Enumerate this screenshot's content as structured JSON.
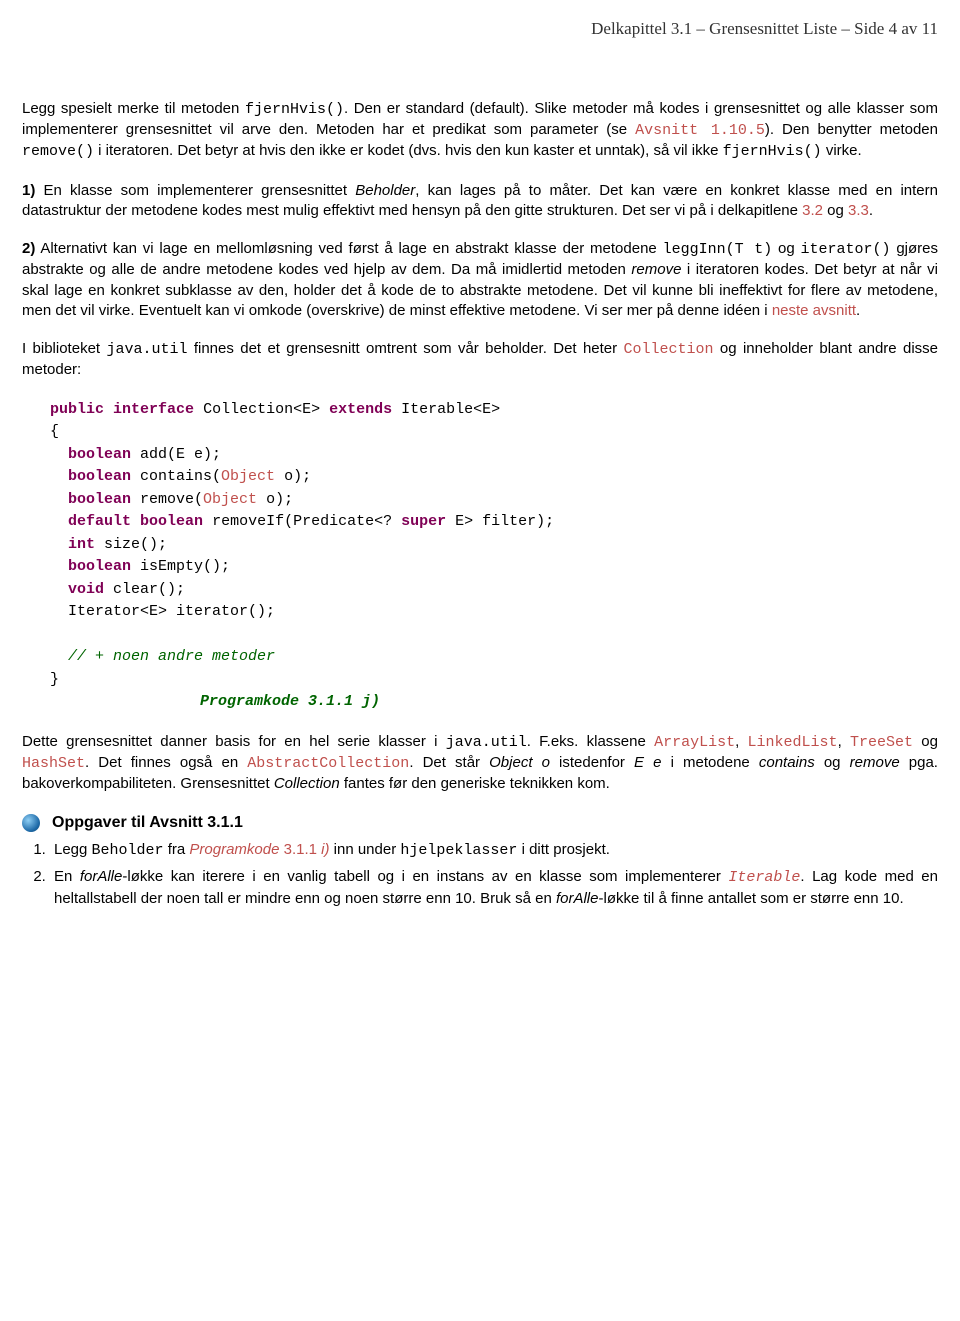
{
  "header": {
    "text": "Delkapittel 3.1 – Grensesnittet Liste  –   Side 4 av 11"
  },
  "para1": {
    "t1": "Legg spesielt merke til metoden ",
    "code1": "fjernHvis()",
    "t2": ". Den er standard (default). Slike metoder må kodes i grensesnittet og alle klasser som implementerer grensesnittet vil arve den. Metoden har et predikat som parameter (se ",
    "link1": "Avsnitt 1.10.5",
    "t3": "). Den benytter metoden ",
    "code2": "remove()",
    "t4": " i iteratoren. Det betyr at hvis den ikke er kodet (dvs. hvis den kun kaster et unntak), så vil ikke ",
    "code3": "fjernHvis()",
    "t5": " virke."
  },
  "para2": {
    "bold1": "1)",
    "t1": " En klasse som implementerer grensesnittet ",
    "it1": "Beholder",
    "t2": ", kan lages på to måter. Det kan være en konkret klasse med en intern datastruktur der metodene kodes mest mulig effektivt med hensyn på den gitte strukturen. Det ser vi på i delkapitlene ",
    "link1": "3.2",
    "t3": " og ",
    "link2": "3.3",
    "t4": "."
  },
  "para3": {
    "bold1": "2)",
    "t1": " Alternativt kan vi lage en mellomløsning ved først å lage en abstrakt klasse der metodene ",
    "code1": "leggInn(T t)",
    "t2": " og ",
    "code2": "iterator()",
    "t3": " gjøres abstrakte og alle de andre metodene kodes ved hjelp av dem. Da må imidlertid metoden ",
    "it1": "remove",
    "t4": " i iteratoren kodes. Det betyr at når vi skal lage en konkret subklasse av den, holder det å kode de to abstrakte metodene. Det vil kunne bli ineffektivt for flere av metodene, men det vil virke. Eventuelt kan vi omkode (overskrive) de minst effektive metodene. Vi ser mer på denne idéen i ",
    "link1": "neste avsnitt",
    "t5": "."
  },
  "para4": {
    "t1": "I biblioteket ",
    "code1": "java.util",
    "t2": " finnes det et grensesnitt omtrent som vår beholder. Det heter ",
    "link1": "Collection",
    "t3": " og inneholder blant andre disse metoder:"
  },
  "codeblock": {
    "kw_public": "public",
    "kw_interface": "interface",
    "name": "Collection<E>",
    "kw_extends": "extends",
    "ext": "Iterable<E>",
    "lbrace": "{",
    "l1_kw": "boolean",
    "l1_rest": " add(E e);",
    "l2_kw": "boolean",
    "l2_rest": " contains(",
    "l2_obj": "Object",
    "l2_rest2": " o);",
    "l3_kw": "boolean",
    "l3_rest": " remove(",
    "l3_obj": "Object",
    "l3_rest2": " o);",
    "l4_kw1": "default",
    "l4_kw2": "boolean",
    "l4_rest": " removeIf(Predicate<? ",
    "l4_kw3": "super",
    "l4_rest2": " E> filter);",
    "l5_kw": "int",
    "l5_rest": " size();",
    "l6_kw": "boolean",
    "l6_rest": " isEmpty();",
    "l7_kw": "void",
    "l7_rest": " clear();",
    "l8": "Iterator<E> iterator();",
    "comment": "// + noen andre metoder",
    "rbrace": "}",
    "caption": "Programkode 3.1.1 j)"
  },
  "para5": {
    "t1": "Dette grensesnittet danner basis for en hel serie klasser i ",
    "code1": "java.util",
    "t2": ". F.eks. klassene ",
    "link1": "ArrayList",
    "t3": ", ",
    "link2": "LinkedList",
    "t4": ", ",
    "link3": "TreeSet",
    "t5": " og ",
    "link4": "HashSet",
    "t6": ". Det finnes også en ",
    "link5": "AbstractCollection",
    "t7": ". Det står ",
    "it1": "Object o",
    "t8": " istedenfor ",
    "it2": "E e",
    "t9": " i metodene ",
    "it3": "contains",
    "t10": " og ",
    "it4": "remove",
    "t11": " pga. bakoverkompabiliteten. Grensesnittet ",
    "it5": "Collection",
    "t12": " fantes før den generiske teknikken kom."
  },
  "section": {
    "title": "Oppgaver til Avsnitt 3.1.1"
  },
  "ex1": {
    "t1": "Legg ",
    "code1": "Beholder",
    "t2": " fra ",
    "link1": "Programkode",
    "link2": " 3.1.1 ",
    "link3": "i)",
    "t3": " inn under ",
    "code2": "hjelpeklasser",
    "t4": " i ditt prosjekt."
  },
  "ex2": {
    "t1": "En ",
    "it1": "forAlle",
    "t2": "-løkke kan iterere i en vanlig tabell og i en instans av en klasse som implementerer ",
    "link1": "Iterable",
    "t3": ". Lag kode med en heltallstabell der noen tall er mindre enn og noen større enn 10. Bruk så en ",
    "it2": "forAlle",
    "t4": "-løkke til å finne antallet som er større enn 10."
  }
}
